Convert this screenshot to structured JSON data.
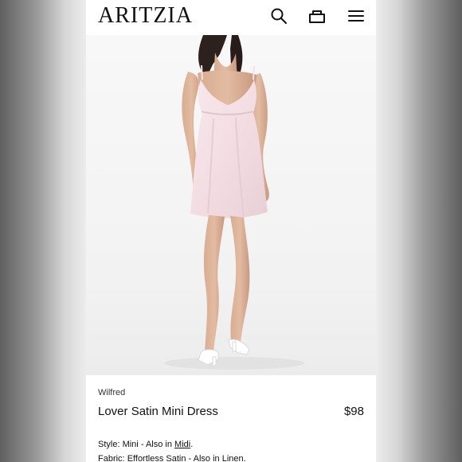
{
  "brand": {
    "name": "ARITZIA"
  },
  "header": {
    "search_icon": "search-icon",
    "bag_icon": "shopping-bag-icon",
    "menu_icon": "menu-icon"
  },
  "product": {
    "designer": "Wilfred",
    "name": "Lover Satin Mini Dress",
    "price": "$98",
    "style_label": "Style:",
    "style_value": "Mini",
    "style_also": "Also in",
    "style_link": "Midi",
    "fabric_label": "Fabric:",
    "fabric_value": "Effortless Satin",
    "fabric_also": "Also in",
    "fabric_link": "Linen"
  },
  "colors": {
    "page_background": "#ffffff",
    "text": "#111111",
    "dress": "#f4dfe4",
    "shoe": "#ffffff"
  }
}
